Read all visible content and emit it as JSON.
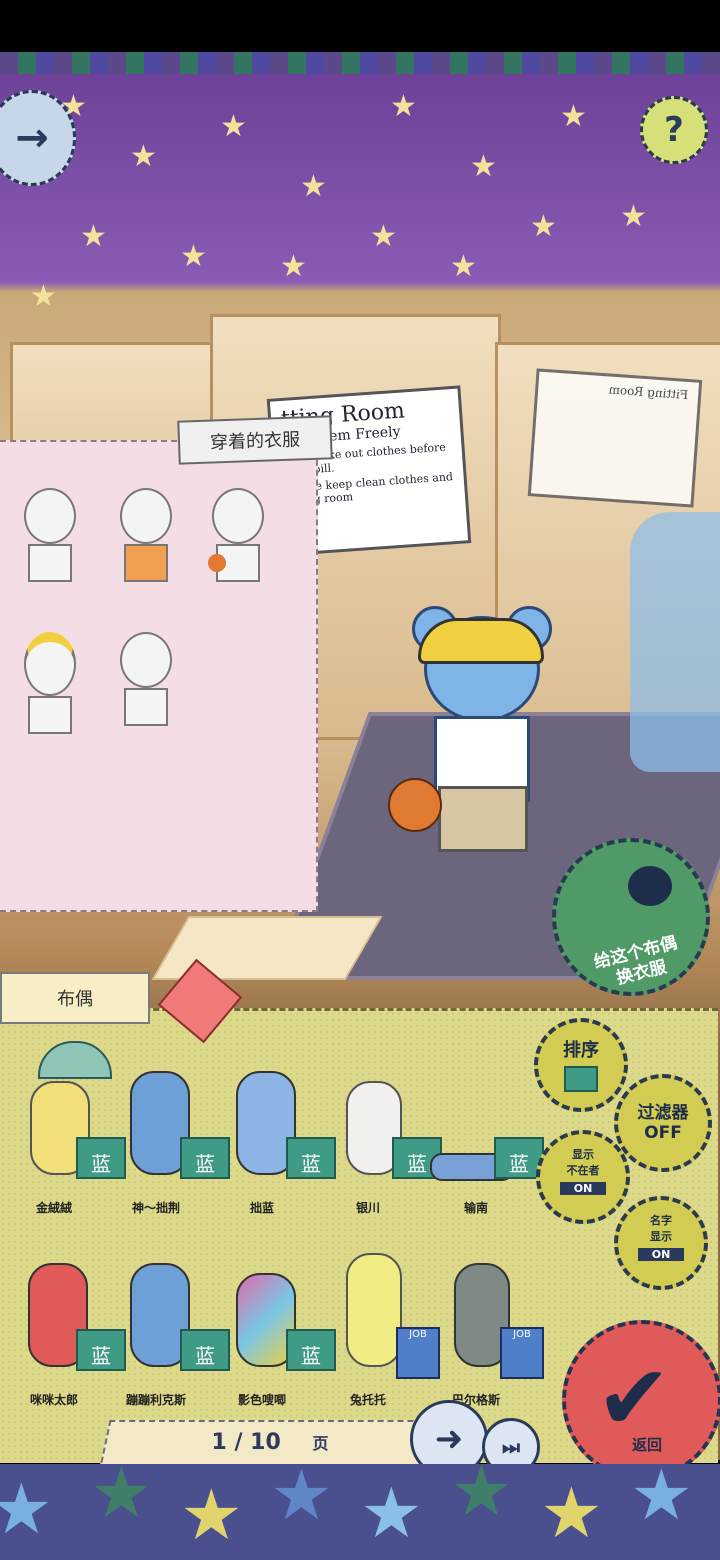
{
  "header": {
    "next_arrow": "→",
    "help": "?"
  },
  "clothes_panel": {
    "title": "穿着的衣服"
  },
  "fitting_room_sign": {
    "title": "tting Room",
    "subtitle": "Try Them Freely",
    "rules": [
      "Don't take out clothes before your bill.",
      "Please keep clean clothes and fitting room"
    ]
  },
  "change_clothes_button": {
    "label_line1": "给这个布偶",
    "label_line2": "换衣服"
  },
  "plush_panel": {
    "tab_label": "布偶",
    "items": [
      {
        "name": "金絨絨",
        "badge": "蓝"
      },
      {
        "name": "神～拙荆",
        "badge": "蓝"
      },
      {
        "name": "拙蓝",
        "badge": "蓝"
      },
      {
        "name": "银川",
        "badge": "蓝"
      },
      {
        "name": "输南",
        "badge": "蓝"
      },
      {
        "name": "咪咪太郎",
        "badge": "蓝"
      },
      {
        "name": "蹦蹦利克斯",
        "badge": "蓝"
      },
      {
        "name": "影色嗖唧",
        "badge": "蓝"
      },
      {
        "name": "兔托托",
        "badge": "JOB"
      },
      {
        "name": "巴尔格斯",
        "badge": "JOB"
      }
    ]
  },
  "side_buttons": {
    "sort": {
      "label": "排序"
    },
    "filter": {
      "label": "过滤器",
      "state": "OFF"
    },
    "show_absent": {
      "label_line1": "显示",
      "label_line2": "不在者",
      "state": "ON"
    },
    "show_name": {
      "label_line1": "名字",
      "label_line2": "显示",
      "state": "ON"
    }
  },
  "return_button": {
    "label": "返回"
  },
  "pager": {
    "text": "1 / 10",
    "unit": "页"
  }
}
